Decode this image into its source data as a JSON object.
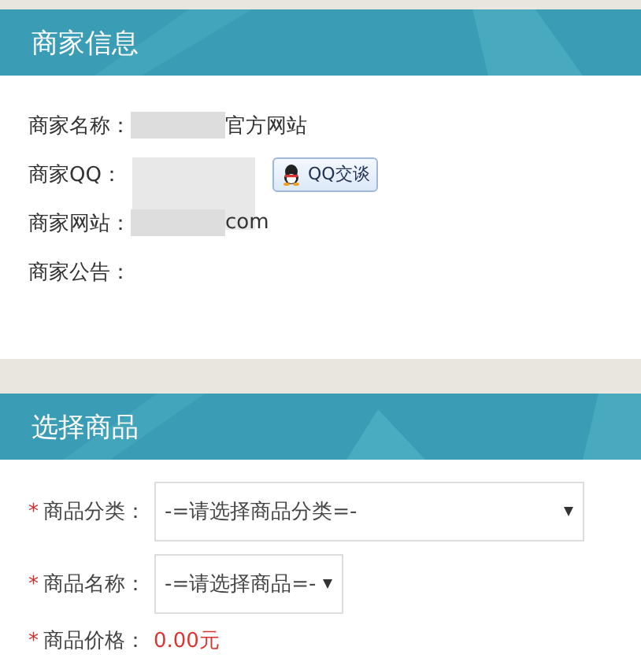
{
  "merchant_info": {
    "title": "商家信息",
    "fields": [
      {
        "label": "商家名称：",
        "value": "官方网站",
        "redacted": true
      },
      {
        "label": "商家QQ：",
        "redacted": true,
        "chat_button": "QQ交谈"
      },
      {
        "label": "商家网站：",
        "value": "com",
        "redacted": true
      },
      {
        "label": "商家公告：",
        "redacted": false
      }
    ]
  },
  "select_product": {
    "title": "选择商品",
    "fields": [
      {
        "kind": "select",
        "required_mark": "*",
        "label": "商品分类：",
        "value": "-=请选择商品分类=-",
        "wide": true
      },
      {
        "kind": "select",
        "required_mark": "*",
        "label": "商品名称：",
        "value": "-=请选择商品=-",
        "wide": false
      },
      {
        "kind": "price",
        "required_mark": "*",
        "label": "商品价格：",
        "value": "0.00元"
      }
    ]
  }
}
